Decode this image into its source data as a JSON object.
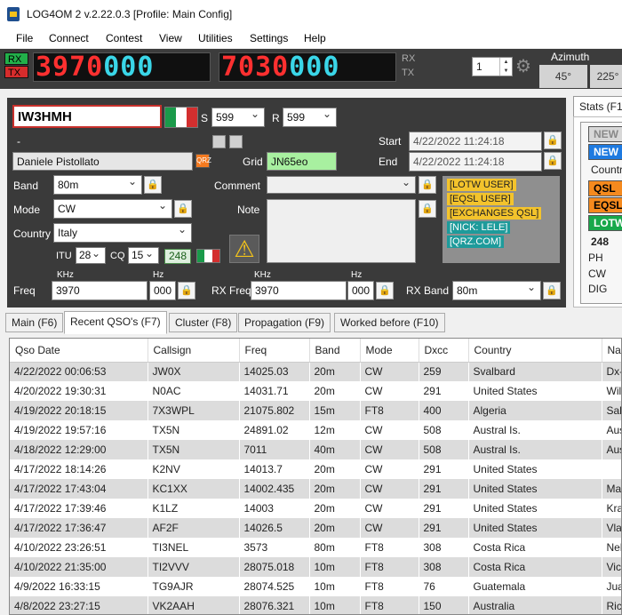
{
  "window": {
    "title": "LOG4OM 2 v.2.22.0.3 [Profile: Main Config]"
  },
  "menu": [
    "File",
    "Connect",
    "Contest",
    "View",
    "Utilities",
    "Settings",
    "Help"
  ],
  "radio": {
    "rx_label": "RX",
    "tx_label": "TX",
    "rx_freq_red": "3970",
    "rx_freq_cyan": "000",
    "tx_freq_red": "7030",
    "tx_freq_cyan": "000",
    "side_rx": "RX",
    "side_tx": "TX",
    "counter": "1",
    "azimuth_label": "Azimuth",
    "azimuth_short": "45°",
    "azimuth_long": "225°"
  },
  "qso": {
    "callsign": "IW3HMH",
    "s_label": "S",
    "s_value": "599",
    "r_label": "R",
    "r_value": "599",
    "dash": "-",
    "name": "Daniele Pistollato",
    "grid_label": "Grid",
    "grid_value": "JN65eo",
    "start_label": "Start",
    "start_value": "4/22/2022 11:24:18",
    "end_label": "End",
    "end_value": "4/22/2022 11:24:18",
    "band_label": "Band",
    "band_value": "80m",
    "mode_label": "Mode",
    "mode_value": "CW",
    "country_label": "Country",
    "country_value": "Italy",
    "comment_label": "Comment",
    "comment_value": "",
    "note_label": "Note",
    "itu_label": "ITU",
    "itu_value": "28",
    "cq_label": "CQ",
    "cq_value": "15",
    "dxcc_value": "248",
    "freq_label": "Freq",
    "khz_label": "KHz",
    "hz_label": "Hz",
    "freq_khz": "3970",
    "freq_hz": "000",
    "rxfreq_label": "RX Freq",
    "rxfreq_khz_label": "KHz",
    "rxfreq_hz_label": "Hz",
    "rxfreq_khz": "3970",
    "rxfreq_hz": "000",
    "rxband_label": "RX Band",
    "rxband_value": "80m"
  },
  "badges": [
    {
      "text": "[LOTW USER]",
      "color": "#f3c32c"
    },
    {
      "text": "[EQSL USER]",
      "color": "#f3c32c"
    },
    {
      "text": "[EXCHANGES QSL]",
      "color": "#f3c32c"
    },
    {
      "text": "[NICK: LELE]",
      "color": "#1e9b9b"
    },
    {
      "text": "[QRZ.COM]",
      "color": "#1e9b9b"
    }
  ],
  "stats": {
    "tab_label": "Stats (F1",
    "new1": "NEW",
    "new2": "NEW",
    "country": "Countr",
    "qsl": "QSL",
    "eqsl": "EQSL",
    "lotw": "LOTW",
    "count": "248",
    "ph": "PH",
    "cw": "CW",
    "dig": "DIG"
  },
  "tabs": [
    "Main (F6)",
    "Recent QSO's (F7)",
    "Cluster (F8)",
    "Propagation (F9)",
    "Worked before (F10)"
  ],
  "table": {
    "columns": [
      "Qso Date",
      "Callsign",
      "Freq",
      "Band",
      "Mode",
      "Dxcc",
      "Country",
      "Nam"
    ],
    "rows": [
      [
        "4/22/2022 00:06:53",
        "JW0X",
        "14025.03",
        "20m",
        "CW",
        "259",
        "Svalbard",
        "Dx-F"
      ],
      [
        "4/20/2022 19:30:31",
        "N0AC",
        "14031.71",
        "20m",
        "CW",
        "291",
        "United States",
        "Willi"
      ],
      [
        "4/19/2022 20:18:15",
        "7X3WPL",
        "21075.802",
        "15m",
        "FT8",
        "400",
        "Algeria",
        "Saha"
      ],
      [
        "4/19/2022 19:57:16",
        "TX5N",
        "24891.02",
        "12m",
        "CW",
        "508",
        "Austral Is.",
        "Aust"
      ],
      [
        "4/18/2022 12:29:00",
        "TX5N",
        "7011",
        "40m",
        "CW",
        "508",
        "Austral Is.",
        "Aust"
      ],
      [
        "4/17/2022 18:14:26",
        "K2NV",
        "14013.7",
        "20m",
        "CW",
        "291",
        "United States",
        ""
      ],
      [
        "4/17/2022 17:43:04",
        "KC1XX",
        "14002.435",
        "20m",
        "CW",
        "291",
        "United States",
        "Matt"
      ],
      [
        "4/17/2022 17:39:46",
        "K1LZ",
        "14003",
        "20m",
        "CW",
        "291",
        "United States",
        "Kras"
      ],
      [
        "4/17/2022 17:36:47",
        "AF2F",
        "14026.5",
        "20m",
        "CW",
        "291",
        "United States",
        "Vlad"
      ],
      [
        "4/10/2022 23:26:51",
        "TI3NEL",
        "3573",
        "80m",
        "FT8",
        "308",
        "Costa Rica",
        "Nels"
      ],
      [
        "4/10/2022 21:35:00",
        "TI2VVV",
        "28075.018",
        "10m",
        "FT8",
        "308",
        "Costa Rica",
        "Vict"
      ],
      [
        "4/9/2022 16:33:15",
        "TG9AJR",
        "28074.525",
        "10m",
        "FT8",
        "76",
        "Guatemala",
        "Juan"
      ],
      [
        "4/8/2022 23:27:15",
        "VK2AAH",
        "28076.321",
        "10m",
        "FT8",
        "150",
        "Australia",
        "Rich"
      ]
    ]
  }
}
